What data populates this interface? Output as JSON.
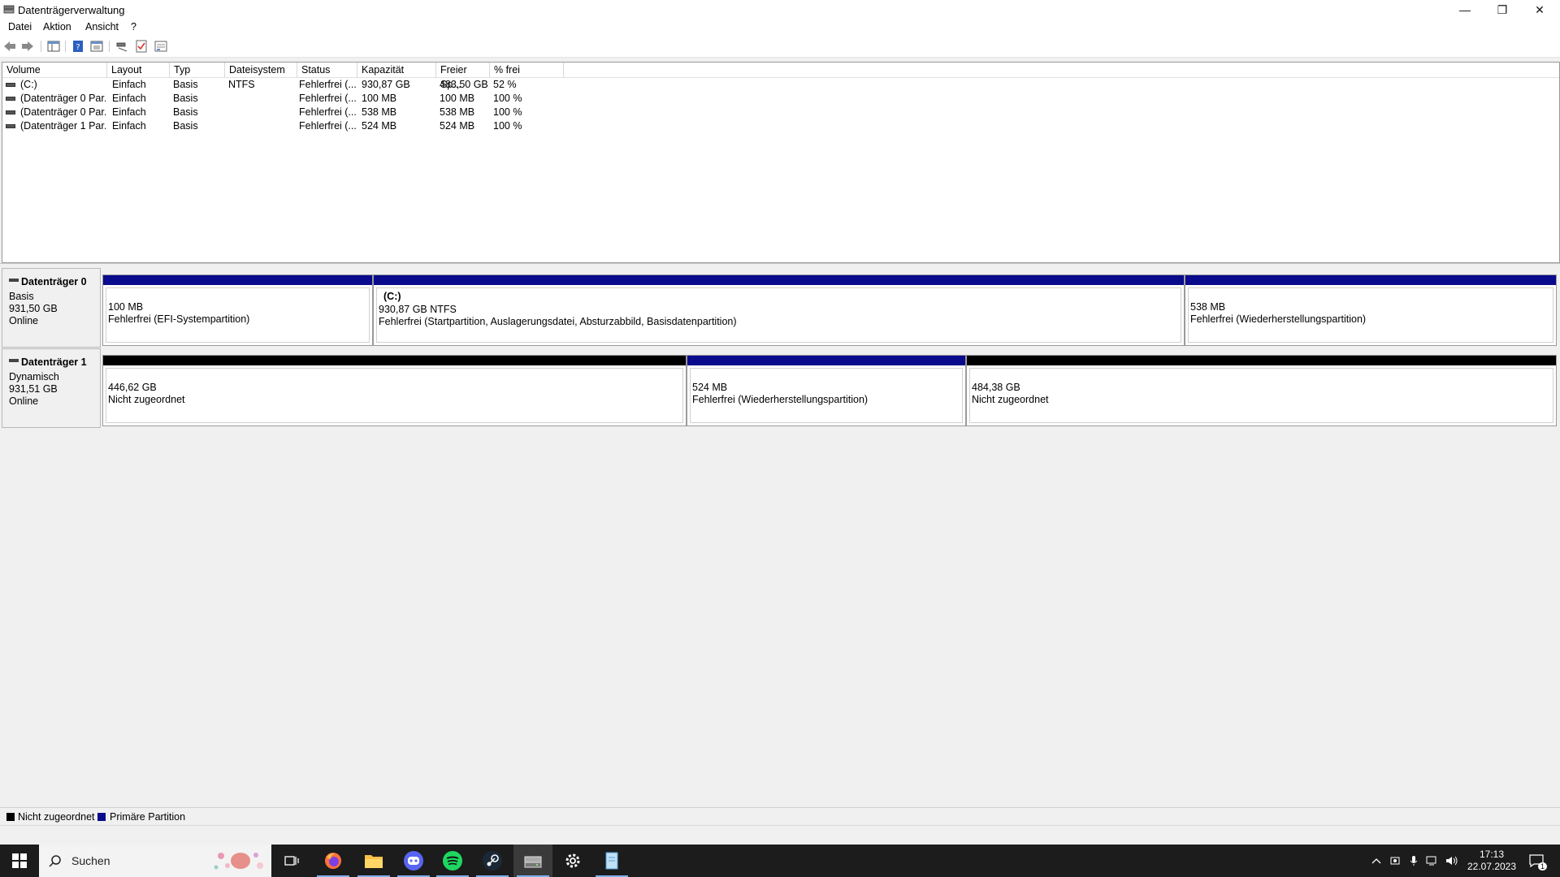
{
  "window": {
    "title": "Datenträgerverwaltung",
    "minimize": "—",
    "restore": "❐",
    "close": "✕"
  },
  "menu": [
    "Datei",
    "Aktion",
    "Ansicht",
    "?"
  ],
  "volume_list": {
    "columns": [
      "Volume",
      "Layout",
      "Typ",
      "Dateisystem",
      "Status",
      "Kapazität",
      "Freier Sp...",
      "% frei"
    ],
    "rows": [
      [
        "(C:)",
        "Einfach",
        "Basis",
        "NTFS",
        "Fehlerfrei (...",
        "930,87 GB",
        "483,50 GB",
        "52 %"
      ],
      [
        "(Datenträger 0 Par...",
        "Einfach",
        "Basis",
        "",
        "Fehlerfrei (...",
        "100 MB",
        "100 MB",
        "100 %"
      ],
      [
        "(Datenträger 0 Par...",
        "Einfach",
        "Basis",
        "",
        "Fehlerfrei (...",
        "538 MB",
        "538 MB",
        "100 %"
      ],
      [
        "(Datenträger 1 Par...",
        "Einfach",
        "Basis",
        "",
        "Fehlerfrei (...",
        "524 MB",
        "524 MB",
        "100 %"
      ]
    ]
  },
  "disks": [
    {
      "name": "Datenträger 0",
      "type": "Basis",
      "size": "931,50 GB",
      "state": "Online",
      "partitions": [
        {
          "label": "",
          "size": "100 MB",
          "status": "Fehlerfrei (EFI-Systempartition)",
          "kind": "primary"
        },
        {
          "label": "(C:)",
          "size": "930,87 GB NTFS",
          "status": "Fehlerfrei (Startpartition, Auslagerungsdatei, Absturzabbild, Basisdatenpartition)",
          "kind": "primary"
        },
        {
          "label": "",
          "size": "538 MB",
          "status": "Fehlerfrei (Wiederherstellungspartition)",
          "kind": "primary"
        }
      ]
    },
    {
      "name": "Datenträger 1",
      "type": "Dynamisch",
      "size": "931,51 GB",
      "state": "Online",
      "partitions": [
        {
          "label": "",
          "size": "446,62 GB",
          "status": "Nicht zugeordnet",
          "kind": "unallocated"
        },
        {
          "label": "",
          "size": "524 MB",
          "status": "Fehlerfrei (Wiederherstellungspartition)",
          "kind": "primary"
        },
        {
          "label": "",
          "size": "484,38 GB",
          "status": "Nicht zugeordnet",
          "kind": "unallocated"
        }
      ]
    }
  ],
  "legend": {
    "unallocated": "Nicht zugeordnet",
    "primary": "Primäre Partition"
  },
  "colors": {
    "primary": "#0a0a8c",
    "unallocated": "#000000"
  },
  "taskbar": {
    "search_placeholder": "Suchen",
    "time": "17:13",
    "date": "22.07.2023",
    "notifications": "1"
  }
}
